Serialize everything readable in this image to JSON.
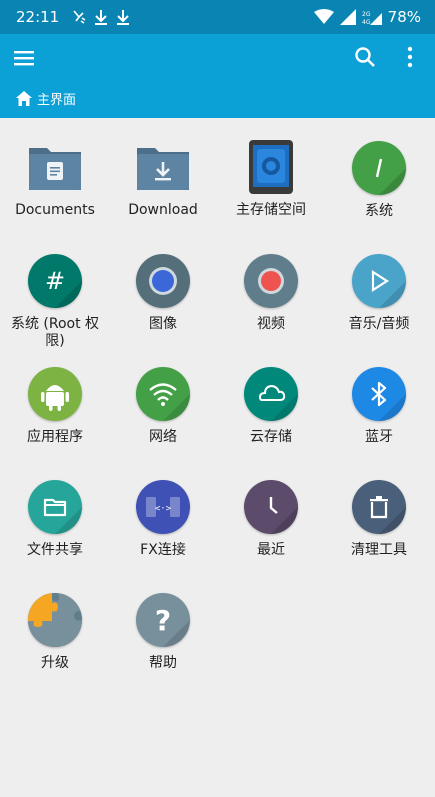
{
  "status_bar": {
    "time": "22:11",
    "battery": "78%",
    "network_small": "2G 4G"
  },
  "app_bar": {
    "menu_icon": "hamburger-menu-icon",
    "search_icon": "search-icon",
    "more_icon": "more-vert-icon",
    "breadcrumb_home_icon": "home-icon",
    "breadcrumb": "主界面"
  },
  "colors": {
    "status_bar": "#0a85b3",
    "app_bar": "#0ba0d6",
    "background": "#eeeeee"
  },
  "items": [
    {
      "label": "Documents",
      "icon": "folder-document-icon"
    },
    {
      "label": "Download",
      "icon": "folder-download-icon"
    },
    {
      "label": "主存储空间",
      "icon": "phone-storage-icon"
    },
    {
      "label": "系统",
      "icon": "system-icon"
    },
    {
      "label": "系统 (Root 权限)",
      "icon": "root-hash-icon"
    },
    {
      "label": "图像",
      "icon": "image-lens-icon"
    },
    {
      "label": "视频",
      "icon": "video-record-icon"
    },
    {
      "label": "音乐/音频",
      "icon": "play-icon"
    },
    {
      "label": "应用程序",
      "icon": "android-icon"
    },
    {
      "label": "网络",
      "icon": "wifi-icon"
    },
    {
      "label": "云存储",
      "icon": "cloud-icon"
    },
    {
      "label": "蓝牙",
      "icon": "bluetooth-icon"
    },
    {
      "label": "文件共享",
      "icon": "folder-share-icon"
    },
    {
      "label": "FX连接",
      "icon": "fx-connect-icon"
    },
    {
      "label": "最近",
      "icon": "clock-icon"
    },
    {
      "label": "清理工具",
      "icon": "trash-icon"
    },
    {
      "label": "升级",
      "icon": "puzzle-icon"
    },
    {
      "label": "帮助",
      "icon": "help-question-icon"
    }
  ]
}
